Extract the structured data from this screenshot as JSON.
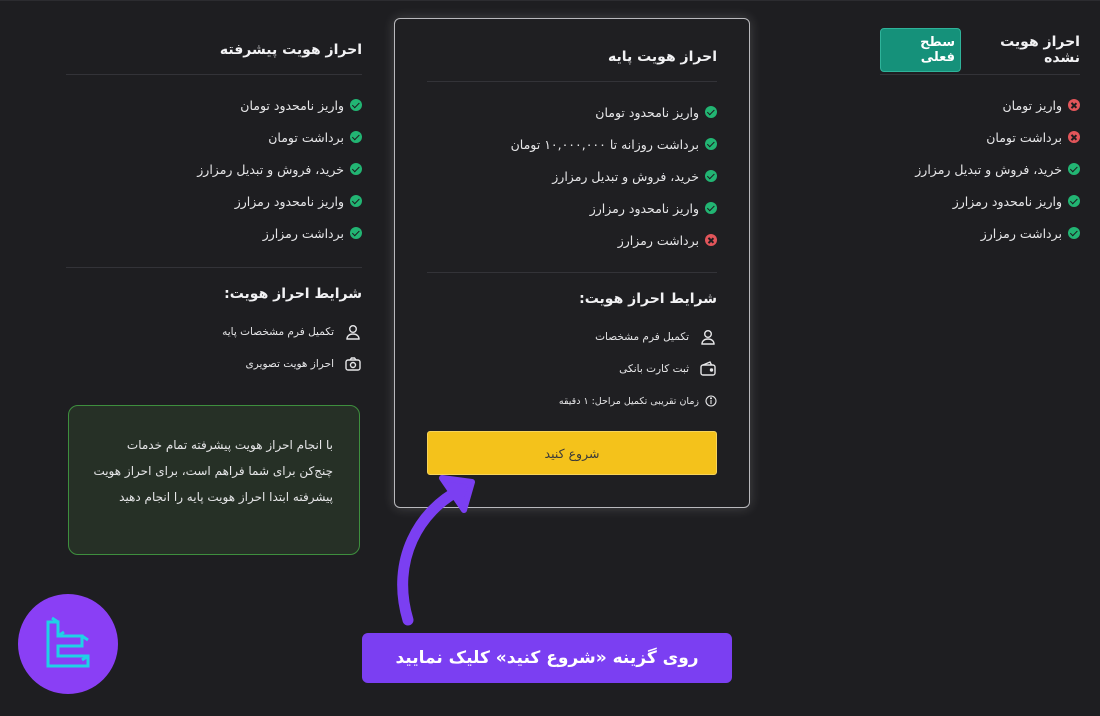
{
  "colors": {
    "accent_purple": "#7b3ff2",
    "button_yellow": "#f4c21b",
    "badge_green": "#15917a",
    "ok_green": "#22b573",
    "fail_red": "#e2555a"
  },
  "level0": {
    "title": "احراز هویت نشده",
    "badge": "سطح فعلی",
    "features": [
      {
        "label": "واریز تومان",
        "status": "fail"
      },
      {
        "label": "برداشت تومان",
        "status": "fail"
      },
      {
        "label": "خرید، فروش و تبدیل رمزارز",
        "status": "ok"
      },
      {
        "label": "واریز نامحدود رمزارز",
        "status": "ok"
      },
      {
        "label": "برداشت رمزارز",
        "status": "ok"
      }
    ]
  },
  "level1": {
    "title": "احراز هویت پایه",
    "features": [
      {
        "label": "واریز نامحدود تومان",
        "status": "ok"
      },
      {
        "label": "برداشت روزانه تا ۱۰,۰۰۰,۰۰۰ تومان",
        "status": "ok"
      },
      {
        "label": "خرید، فروش و تبدیل رمزارز",
        "status": "ok"
      },
      {
        "label": "واریز نامحدود رمزارز",
        "status": "ok"
      },
      {
        "label": "برداشت رمزارز",
        "status": "fail"
      }
    ],
    "conditions_title": "شرایط احراز هویت:",
    "conditions": [
      {
        "label": "تکمیل فرم مشخصات",
        "icon": "user-icon"
      },
      {
        "label": "ثبت کارت بانکی",
        "icon": "wallet-icon"
      }
    ],
    "time_note": "زمان تقریبی تکمیل مراحل: ۱ دقیقه",
    "start_button": "شروع کنید"
  },
  "level2": {
    "title": "احراز هویت پیشرفته",
    "features": [
      {
        "label": "واریز نامحدود تومان",
        "status": "ok"
      },
      {
        "label": "برداشت تومان",
        "status": "ok"
      },
      {
        "label": "خرید، فروش و تبدیل رمزارز",
        "status": "ok"
      },
      {
        "label": "واریز نامحدود رمزارز",
        "status": "ok"
      },
      {
        "label": "برداشت رمزارز",
        "status": "ok"
      }
    ],
    "conditions_title": "شرایط احراز هویت:",
    "conditions": [
      {
        "label": "تکمیل فرم مشخصات پایه",
        "icon": "user-icon"
      },
      {
        "label": "احراز هویت تصویری",
        "icon": "camera-icon"
      }
    ],
    "note": "با انجام احراز هویت پیشرفته تمام خدمات چنج‌کن برای شما فراهم است، برای احراز هویت پیشرفته ابتدا احراز هویت پایه را انجام دهید"
  },
  "callout": "روی گزینه «شروع کنید» کلیک نمایید"
}
